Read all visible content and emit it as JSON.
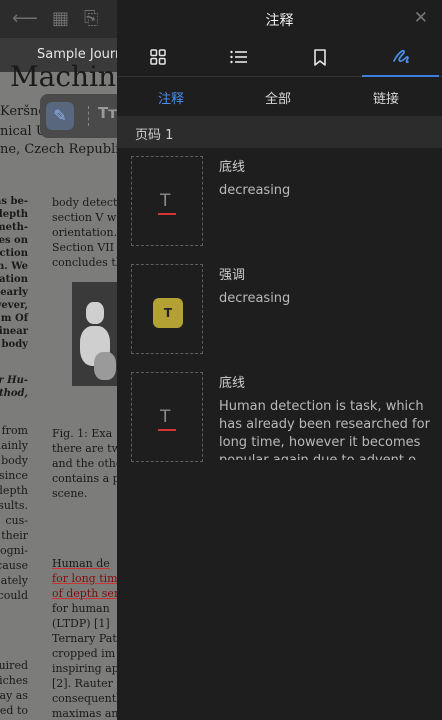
{
  "document": {
    "tab_title": "Sample Journ",
    "heading_fragment": "Machine",
    "lines": [
      "Keršner",
      "nical U",
      "ne, Czech Republic",
      "has be-",
      "depth",
      "meth-",
      "es on",
      "ection",
      "n. We",
      "tation",
      "nearly",
      "wever,",
      "m Of",
      "linear",
      "body",
      "r Hu-",
      "ethod,",
      "from",
      "mainly",
      "body",
      "since",
      "depth",
      "sults.",
      "cus-",
      "their",
      "ogni-",
      "cause",
      "ately",
      "could",
      "uired",
      "iches",
      "ay as",
      "ed to",
      "body detect",
      "section V w",
      "orientation.",
      "Section VII",
      "concludes th",
      "Fig. 1: Exa",
      "there are tw",
      "and the othe",
      "contains a p",
      "scene.",
      "Human de",
      "for long tim",
      "of depth sen",
      "for human",
      "(LTDP) [1]",
      "Ternary Pat",
      "cropped im",
      "inspiring ap",
      "[2]. Rauter",
      "consequentl",
      "maximas an"
    ]
  },
  "panel": {
    "title": "注释",
    "close_icon": "close-icon",
    "tabs": [
      {
        "name": "grid-view",
        "icon": "grid-icon"
      },
      {
        "name": "outline",
        "icon": "list-icon"
      },
      {
        "name": "bookmarks",
        "icon": "bookmark-icon"
      },
      {
        "name": "annotations",
        "icon": "pen-icon",
        "active": true
      }
    ],
    "subtabs": [
      {
        "label": "注释",
        "active": true
      },
      {
        "label": "全部"
      },
      {
        "label": "链接"
      }
    ],
    "section": "页码 1",
    "items": [
      {
        "type": "底线",
        "text": "decreasing",
        "style": "underline"
      },
      {
        "type": "强调",
        "text": "decreasing",
        "style": "highlight"
      },
      {
        "type": "底线",
        "text": "Human detection is task, which has already been researched for long time, however it becomes popular again due to advent o",
        "style": "underline"
      }
    ],
    "thumb_glyph": "T",
    "accent_color": "#3d7fdc",
    "highlight_color": "#b3a233",
    "underline_color": "#d93434"
  }
}
